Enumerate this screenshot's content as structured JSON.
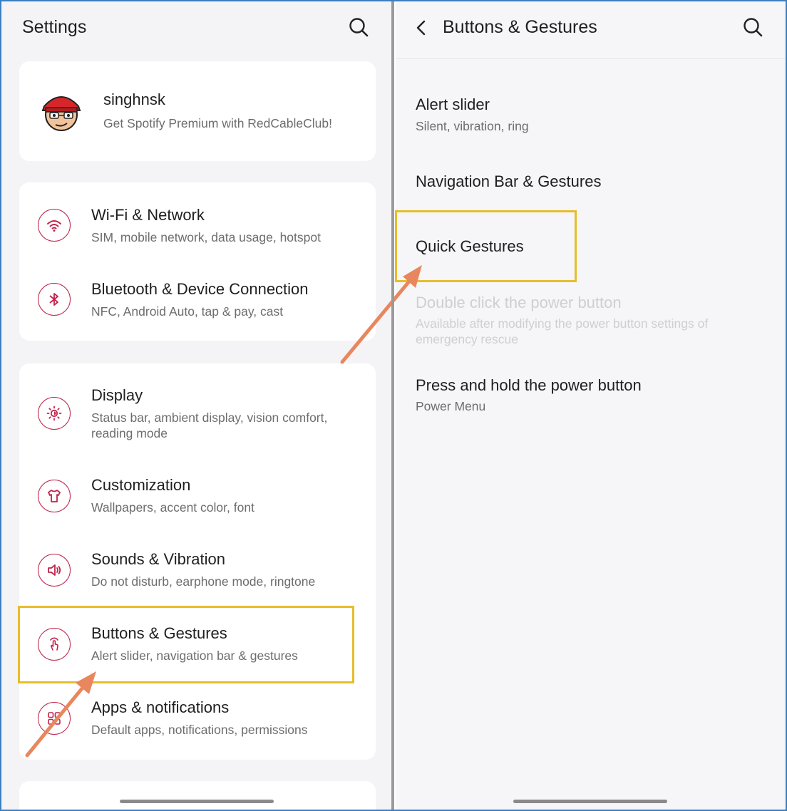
{
  "left": {
    "header": {
      "title": "Settings",
      "search_icon": "search-icon"
    },
    "account": {
      "name": "singhnsk",
      "subtitle": "Get Spotify Premium with RedCableClub!"
    },
    "items": [
      {
        "title": "Wi-Fi & Network",
        "subtitle": "SIM, mobile network, data usage, hotspot",
        "icon": "wifi-icon"
      },
      {
        "title": "Bluetooth & Device Connection",
        "subtitle": "NFC, Android Auto, tap & pay, cast",
        "icon": "bluetooth-icon"
      },
      {
        "title": "Display",
        "subtitle": "Status bar, ambient display, vision comfort, reading mode",
        "icon": "brightness-icon"
      },
      {
        "title": "Customization",
        "subtitle": "Wallpapers, accent color, font",
        "icon": "tshirt-icon"
      },
      {
        "title": "Sounds & Vibration",
        "subtitle": "Do not disturb, earphone mode, ringtone",
        "icon": "speaker-icon"
      },
      {
        "title": "Buttons & Gestures",
        "subtitle": "Alert slider, navigation bar & gestures",
        "icon": "touch-icon"
      },
      {
        "title": "Apps & notifications",
        "subtitle": "Default apps, notifications, permissions",
        "icon": "apps-icon"
      }
    ]
  },
  "right": {
    "header": {
      "title": "Buttons & Gestures",
      "back_icon": "back-icon",
      "search_icon": "search-icon"
    },
    "items": [
      {
        "title": "Alert slider",
        "subtitle": "Silent, vibration, ring"
      },
      {
        "title": "Navigation Bar & Gestures",
        "subtitle": ""
      },
      {
        "title": "Quick Gestures",
        "subtitle": ""
      },
      {
        "title": "Double click the power button",
        "subtitle": "Available after modifying the power button settings of emergency rescue",
        "disabled": true
      },
      {
        "title": "Press and hold the power button",
        "subtitle": "Power Menu"
      }
    ]
  },
  "colors": {
    "accent": "#c0234b",
    "highlight": "#e7bd2c",
    "arrow": "#e8875e"
  }
}
